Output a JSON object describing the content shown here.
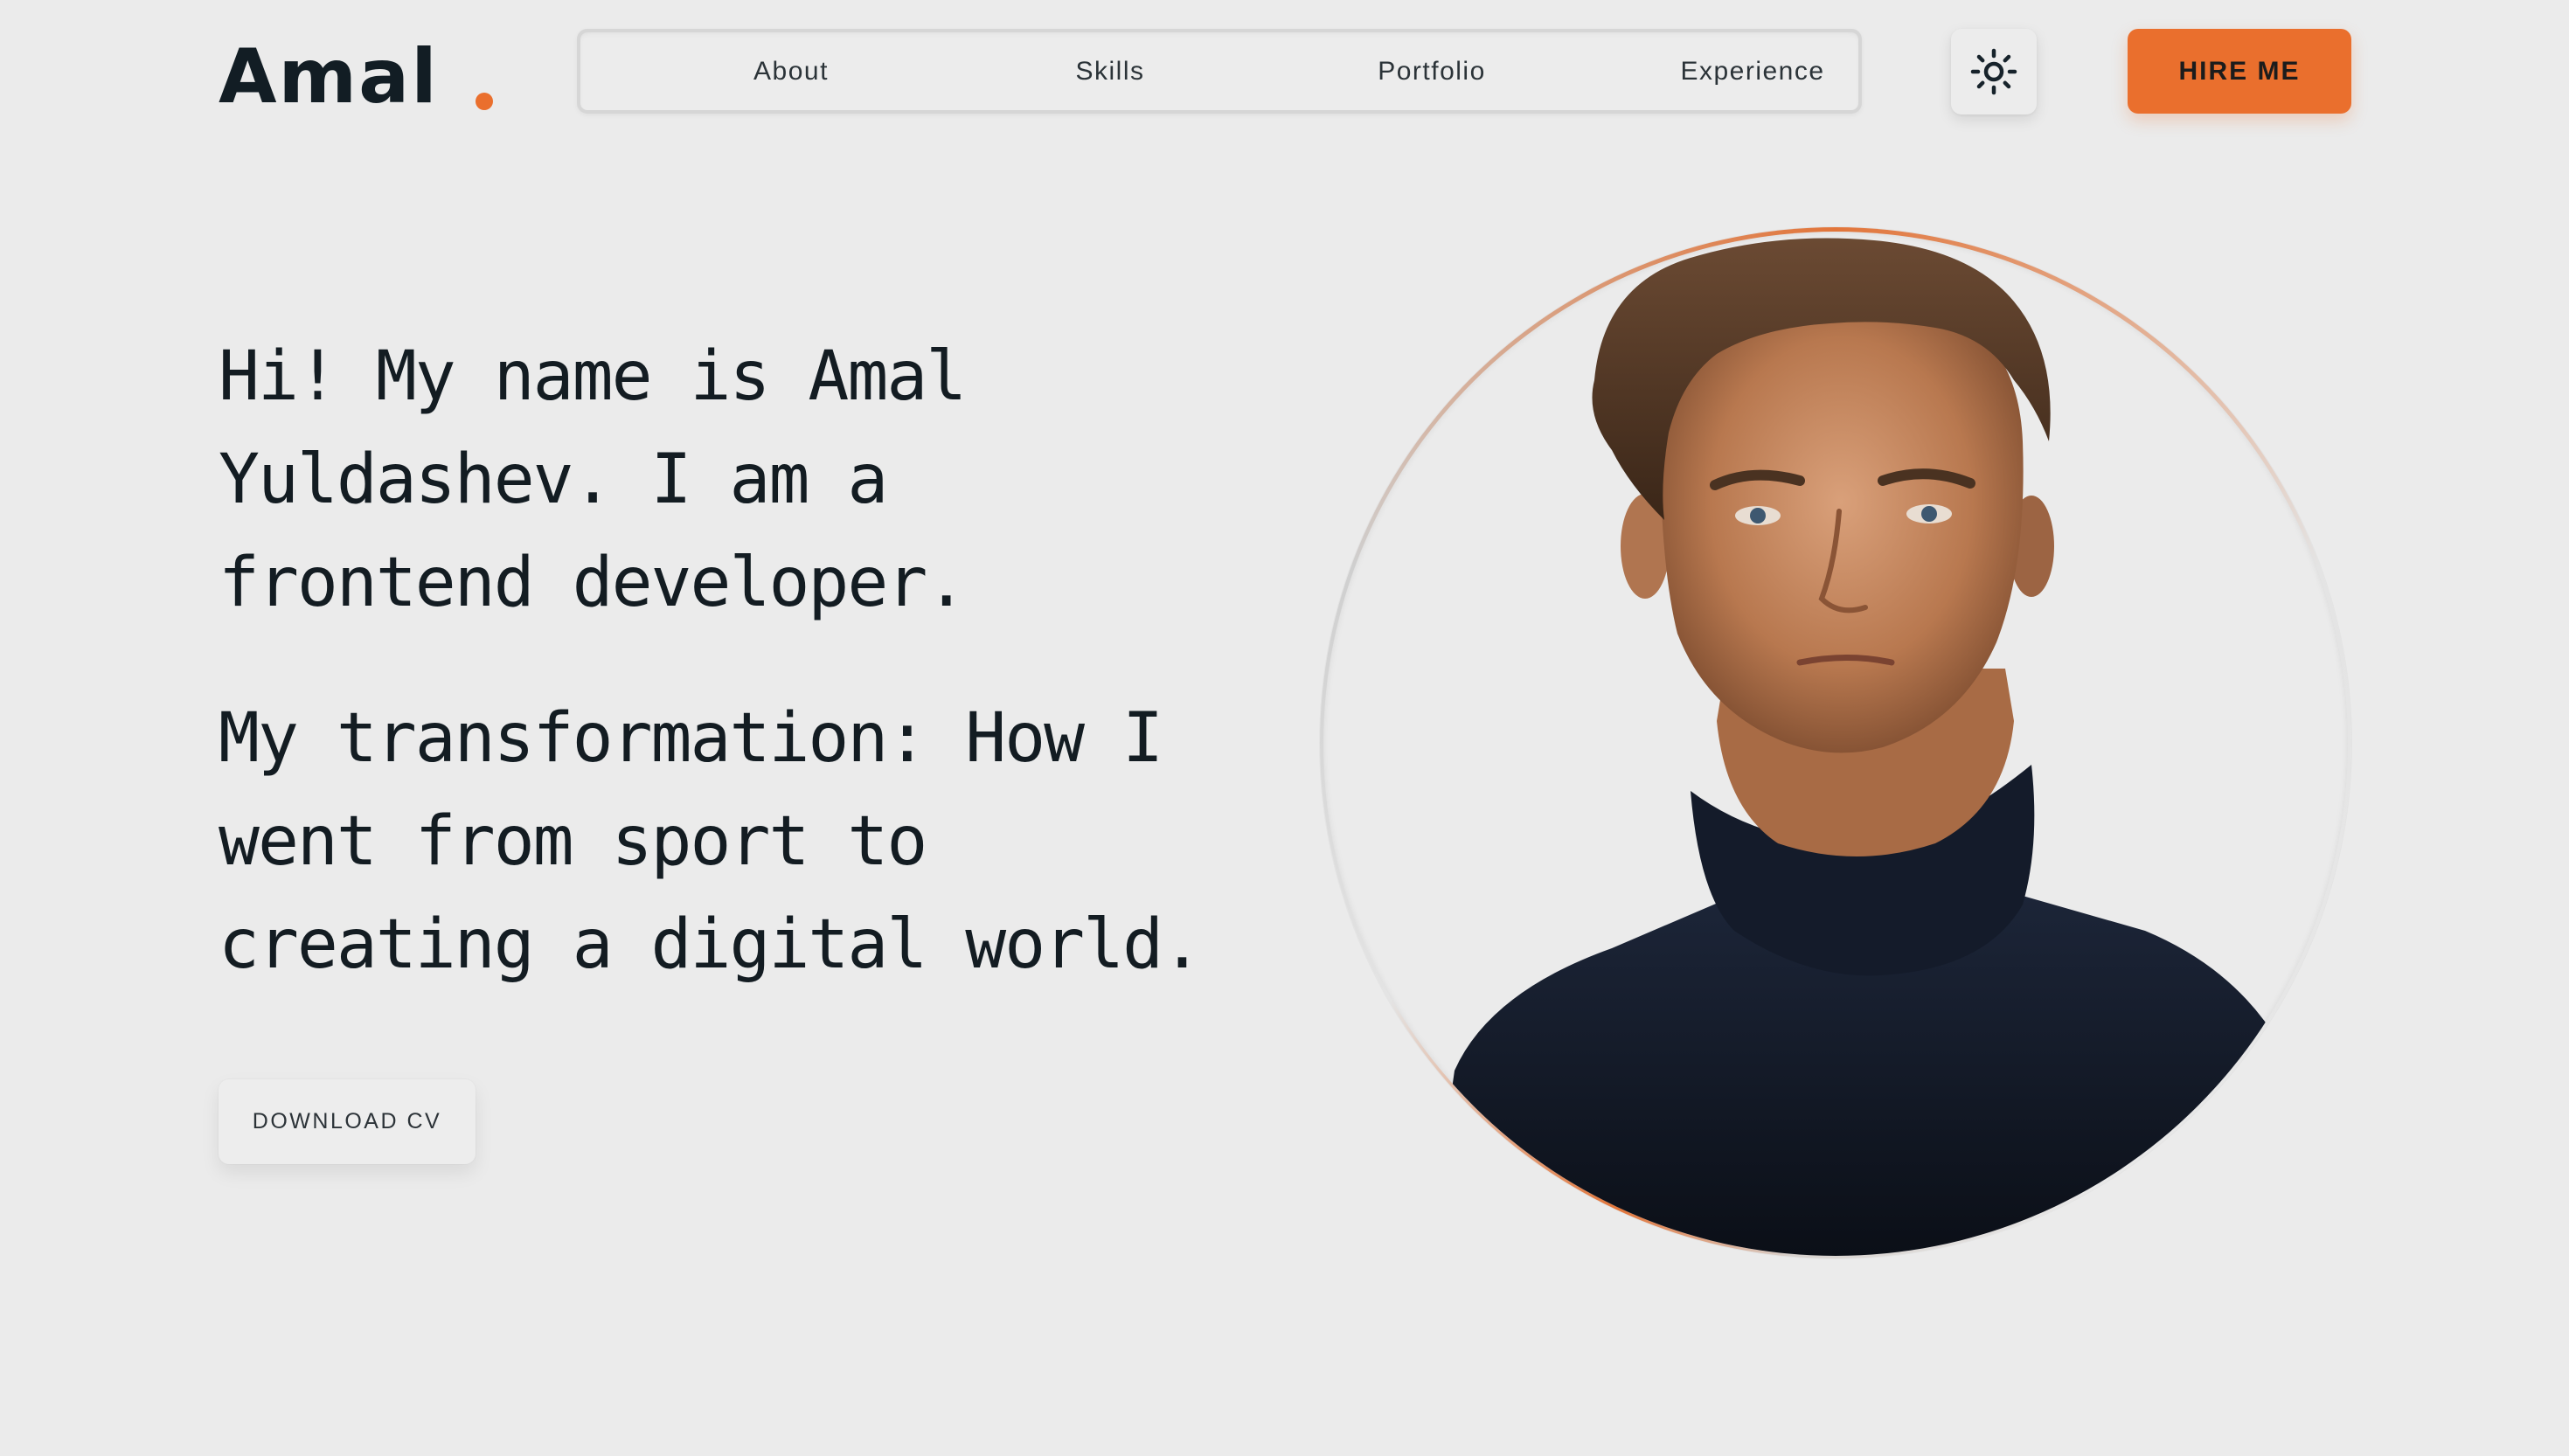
{
  "header": {
    "logo_text": "Amal",
    "nav": {
      "items": [
        {
          "label": "About"
        },
        {
          "label": "Skills"
        },
        {
          "label": "Portfolio"
        },
        {
          "label": "Experience"
        }
      ]
    },
    "theme_toggle_icon": "sun-icon",
    "hire_button_label": "HIRE ME"
  },
  "hero": {
    "intro_lines": [
      "Hi! My name is Amal",
      "Yuldashev. I am a",
      "frontend developer."
    ],
    "story_lines": [
      "My transformation: How I",
      "went from sport to",
      "creating a digital world."
    ],
    "download_button_label": "DOWNLOAD CV"
  },
  "colors": {
    "accent": "#ea6f2d",
    "background": "#ebebeb",
    "text": "#131c22"
  }
}
